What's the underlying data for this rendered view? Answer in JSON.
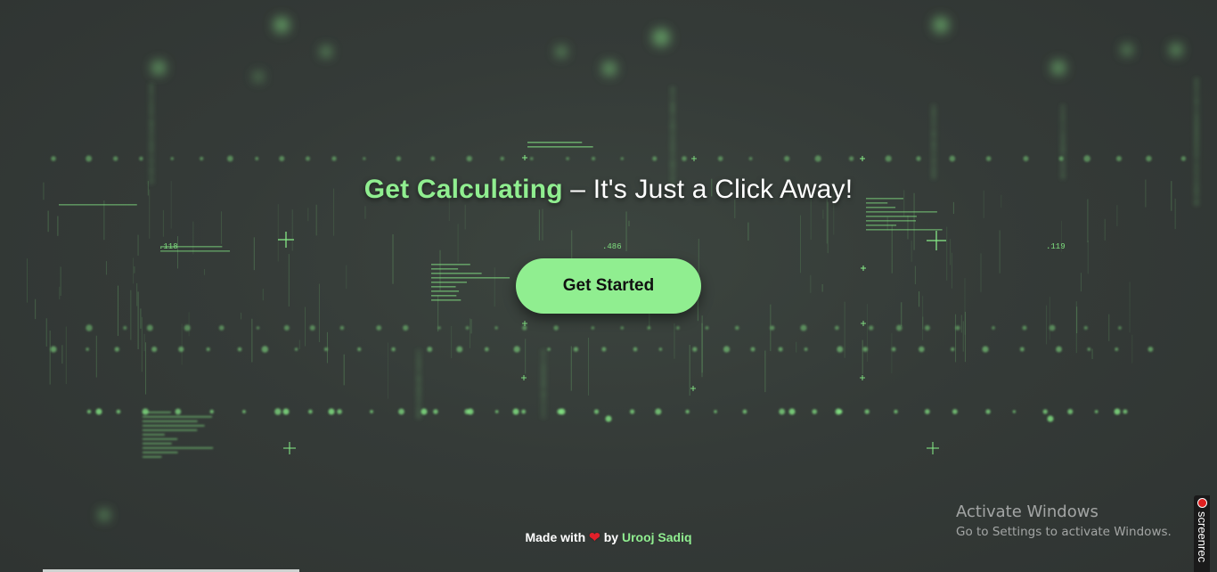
{
  "hero": {
    "headline_accent": "Get Calculating",
    "headline_rest": " – It's Just a Click Away!",
    "cta_label": "Get Started"
  },
  "footer": {
    "made_with": "Made with",
    "heart_glyph": "❤",
    "by": "by",
    "author": "Urooj Sadiq"
  },
  "watermark": {
    "title": "Activate Windows",
    "subtitle": "Go to Settings to activate Windows."
  },
  "recorder": {
    "label": "screenrec"
  },
  "background": {
    "digits": [
      ".118",
      ".486",
      ".119"
    ]
  },
  "colors": {
    "accent": "#90ee90",
    "heart": "#e0202a",
    "background": "#353b38"
  }
}
